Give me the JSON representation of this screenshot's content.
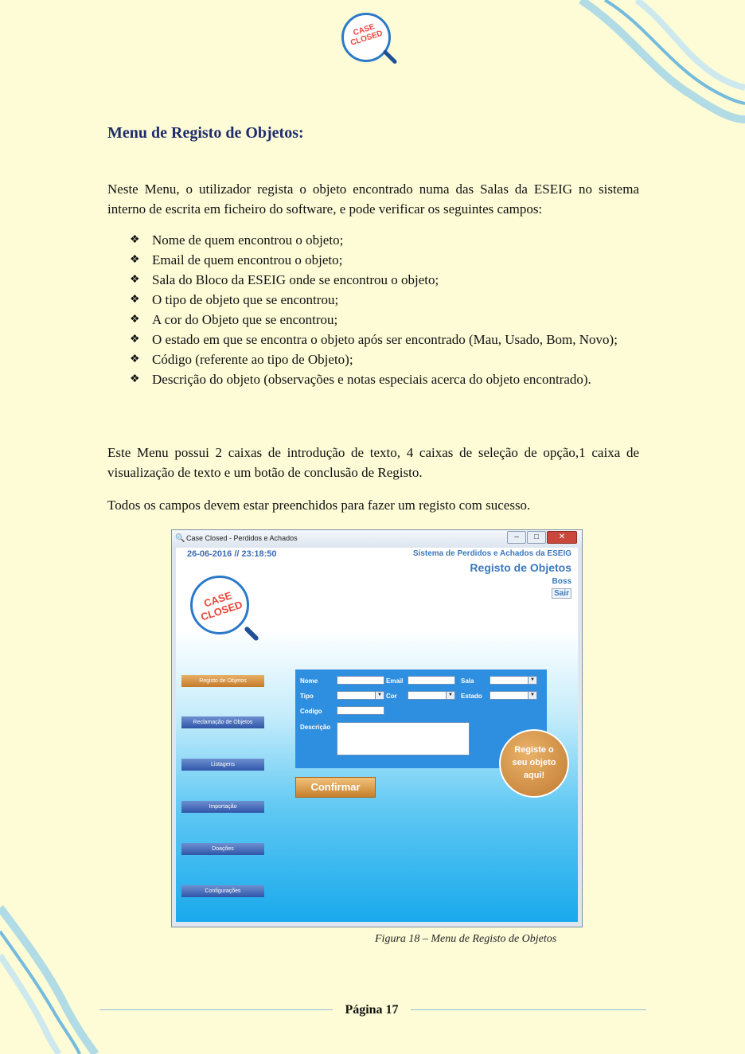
{
  "logo": {
    "text_line1": "CASE",
    "text_line2": "CLOSED"
  },
  "section_title": "Menu de Registo de Objetos:",
  "intro": "Neste Menu, o utilizador regista o objeto encontrado numa das Salas da ESEIG no sistema interno de escrita em ficheiro do software, e pode verificar os seguintes campos:",
  "bullets": [
    "Nome de quem encontrou o objeto;",
    "Email de quem encontrou o objeto;",
    "Sala do Bloco da ESEIG onde se encontrou o objeto;",
    "O tipo de objeto que se encontrou;",
    "A cor do Objeto que se encontrou;",
    "O estado em que se encontra o objeto após ser encontrado (Mau, Usado, Bom, Novo);",
    "Código (referente ao tipo de Objeto);",
    "Descrição do objeto (observações e notas especiais acerca do objeto encontrado)."
  ],
  "summary": "Este Menu possui 2 caixas de introdução de texto, 4 caixas de seleção de opção,1 caixa de visualização de texto e um botão de conclusão de Registo.",
  "note": "Todos os campos devem estar preenchidos para fazer um registo com sucesso.",
  "screenshot": {
    "window_title": "Case Closed - Perdidos e Achados",
    "datetime": "26-06-2016 // 23:18:50",
    "system_name": "Sistema de Perdidos e Achados da ESEIG",
    "page_title": "Registo de Objetos",
    "user": "Boss",
    "logout": "Sair",
    "app_logo_line1": "CASE",
    "app_logo_line2": "CLOSED",
    "nav": [
      "Registo de Objetos",
      "Reclamação de Objetos",
      "Listagens",
      "Importação",
      "Doações",
      "Configurações"
    ],
    "labels": {
      "nome": "Nome",
      "email": "Email",
      "sala": "Sala",
      "tipo": "Tipo",
      "cor": "Cor",
      "estado": "Estado",
      "codigo": "Codigo",
      "descricao": "Descrição"
    },
    "confirm": "Confirmar",
    "badge_line1": "Registe o",
    "badge_line2": "seu objeto",
    "badge_line3": "aqui!"
  },
  "caption": "Figura 18 – Menu de Registo de Objetos",
  "page_number": "Página 17",
  "colors": {
    "page_bg": "#fdfcd7",
    "title": "#1f2d6b",
    "accent_blue": "#3a78bf",
    "orange": "#c77f2c"
  }
}
